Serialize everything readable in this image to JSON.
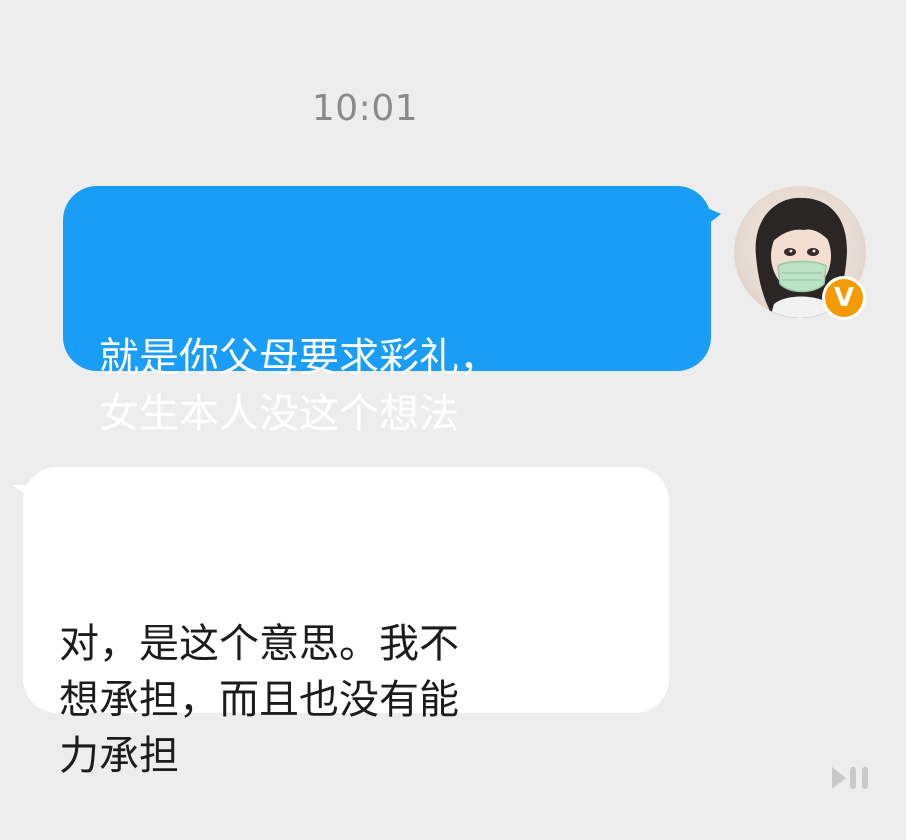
{
  "chat": {
    "timestamp": "10:01",
    "messages": [
      {
        "direction": "outgoing",
        "text": "就是你父母要求彩礼，\n女生本人没这个想法",
        "bubble_color": "#1a9df6",
        "text_color": "#ffffff"
      },
      {
        "direction": "incoming",
        "text": "对，是这个意思。我不\n想承担，而且也没有能\n力承担",
        "bubble_color": "#ffffff",
        "text_color": "#1c1c1c"
      }
    ]
  },
  "sender": {
    "avatar": "avatar-girl-mask",
    "verified_badge": "V",
    "badge_color": "#f59a00"
  },
  "icons": {
    "video_controls": "play-pause-icon"
  },
  "colors": {
    "background": "#ededed",
    "timestamp": "#8a8a8a"
  }
}
